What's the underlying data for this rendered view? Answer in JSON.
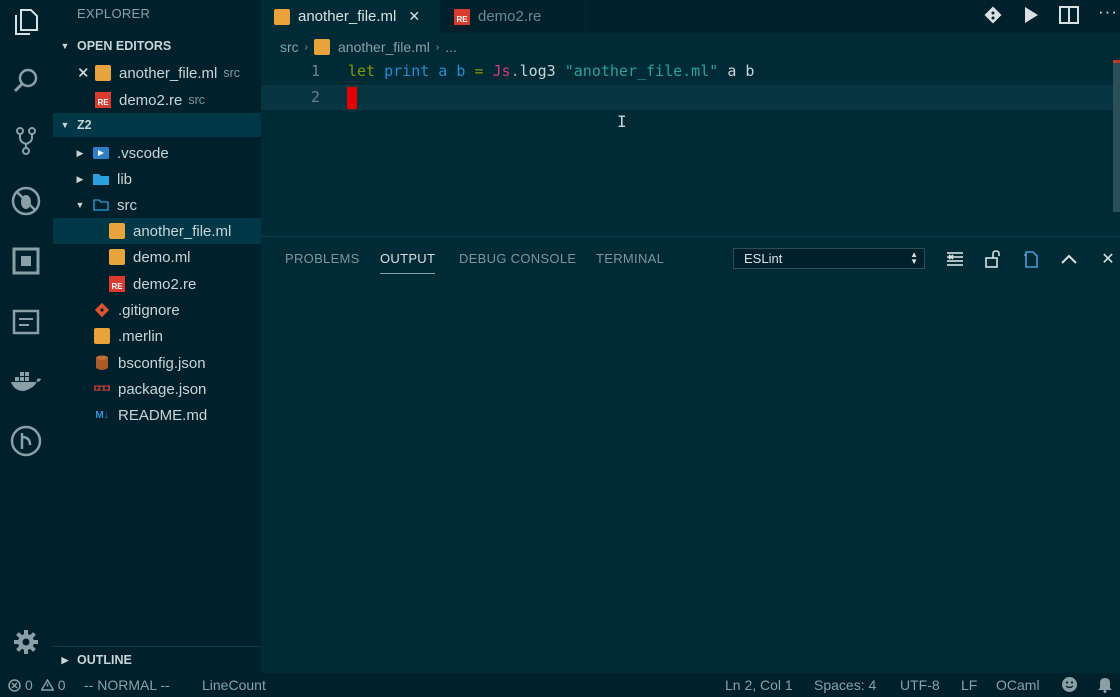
{
  "sidebar": {
    "title": "EXPLORER",
    "open_editors": {
      "header": "OPEN EDITORS",
      "items": [
        {
          "name": "another_file.ml",
          "desc": "src"
        },
        {
          "name": "demo2.re",
          "desc": "src"
        }
      ]
    },
    "workspace": {
      "header": "Z2",
      "items": [
        {
          "name": ".vscode"
        },
        {
          "name": "lib"
        },
        {
          "name": "src"
        },
        {
          "name": "another_file.ml"
        },
        {
          "name": "demo.ml"
        },
        {
          "name": "demo2.re"
        },
        {
          "name": ".gitignore"
        },
        {
          "name": ".merlin"
        },
        {
          "name": "bsconfig.json"
        },
        {
          "name": "package.json"
        },
        {
          "name": "README.md"
        }
      ]
    },
    "outline_header": "OUTLINE"
  },
  "tabs": [
    {
      "label": "another_file.ml",
      "close": "✕"
    },
    {
      "label": "demo2.re"
    }
  ],
  "breadcrumb": {
    "folder": "src",
    "file": "another_file.ml",
    "more": "..."
  },
  "editor": {
    "line_numbers": [
      "1",
      "2"
    ],
    "tokens": {
      "kw": "let",
      "names": "print a b",
      "eq": "=",
      "module": "Js",
      "dot": ".",
      "fn": "log3",
      "str": "\"another_file.ml\"",
      "args": "a b"
    }
  },
  "panel": {
    "tabs": [
      "PROBLEMS",
      "OUTPUT",
      "DEBUG CONSOLE",
      "TERMINAL"
    ],
    "active_tab": "OUTPUT",
    "output_select": "ESLint"
  },
  "statusbar": {
    "errors": "0",
    "warnings": "0",
    "mode": "-- NORMAL --",
    "linecount": "LineCount",
    "position": "Ln 2, Col 1",
    "spaces": "Spaces: 4",
    "encoding": "UTF-8",
    "eol": "LF",
    "language": "OCaml"
  },
  "colors": {
    "background": "#002b36",
    "keyword": "#859900",
    "identifier": "#268bd2",
    "module": "#d33682",
    "string": "#2aa198",
    "cursor": "#e60000"
  }
}
